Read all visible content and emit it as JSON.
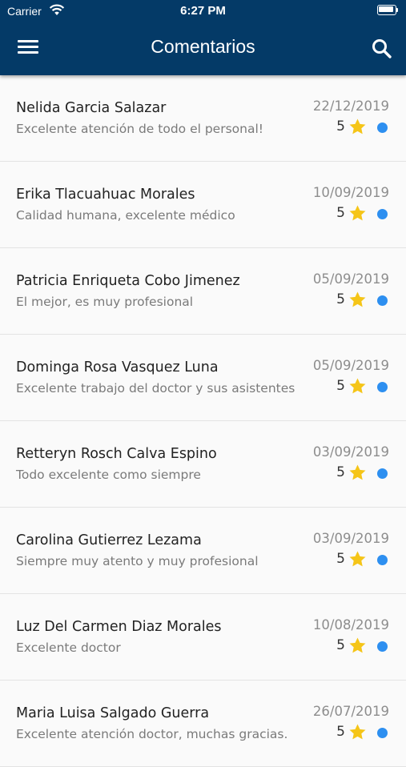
{
  "status_bar": {
    "carrier": "Carrier",
    "time": "6:27 PM"
  },
  "header": {
    "title": "Comentarios"
  },
  "icons": {
    "menu": "menu-icon",
    "search": "search-icon",
    "star": "star-icon",
    "unread": "unread-dot"
  },
  "colors": {
    "header_bg": "#043a67",
    "star": "#f5c518",
    "dot": "#2d8ff0"
  },
  "comments": [
    {
      "name": "Nelida Garcia Salazar",
      "text": "Excelente atención de todo el personal!",
      "date": "22/12/2019",
      "rating": "5"
    },
    {
      "name": "Erika Tlacuahuac Morales",
      "text": "Calidad humana, excelente médico",
      "date": "10/09/2019",
      "rating": "5"
    },
    {
      "name": "Patricia Enriqueta Cobo Jimenez",
      "text": "El mejor, es muy profesional",
      "date": "05/09/2019",
      "rating": "5"
    },
    {
      "name": "Dominga Rosa Vasquez Luna",
      "text": "Excelente trabajo del doctor y sus asistentes",
      "date": "05/09/2019",
      "rating": "5"
    },
    {
      "name": "Retteryn Rosch Calva Espino",
      "text": "Todo excelente como siempre",
      "date": "03/09/2019",
      "rating": "5"
    },
    {
      "name": "Carolina Gutierrez Lezama",
      "text": "Siempre muy atento y muy profesional",
      "date": "03/09/2019",
      "rating": "5"
    },
    {
      "name": "Luz Del Carmen Diaz Morales",
      "text": "Excelente doctor",
      "date": "10/08/2019",
      "rating": "5"
    },
    {
      "name": "Maria Luisa Salgado Guerra",
      "text": "Excelente atención doctor, muchas gracias.",
      "date": "26/07/2019",
      "rating": "5"
    }
  ]
}
